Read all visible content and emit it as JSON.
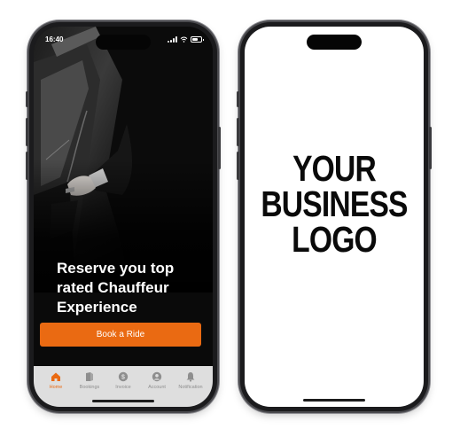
{
  "left_phone": {
    "status": {
      "time": "16:40"
    },
    "hero": {
      "headline": "Reserve you top\nrated Chauffeur\nExperience"
    },
    "cta": {
      "label": "Book a Ride"
    },
    "tabs": [
      {
        "label": "Home",
        "icon": "home-icon",
        "active": true
      },
      {
        "label": "Bookings",
        "icon": "bookings-icon",
        "active": false
      },
      {
        "label": "Invoice",
        "icon": "invoice-icon",
        "active": false
      },
      {
        "label": "Account",
        "icon": "account-icon",
        "active": false
      },
      {
        "label": "Notification",
        "icon": "bell-icon",
        "active": false
      }
    ]
  },
  "right_phone": {
    "logo_text": "YOUR\nBUSINESS\nLOGO"
  },
  "colors": {
    "accent": "#ea6a12",
    "tab_bar": "#dedede",
    "inactive_icon": "#8e8e8e"
  }
}
